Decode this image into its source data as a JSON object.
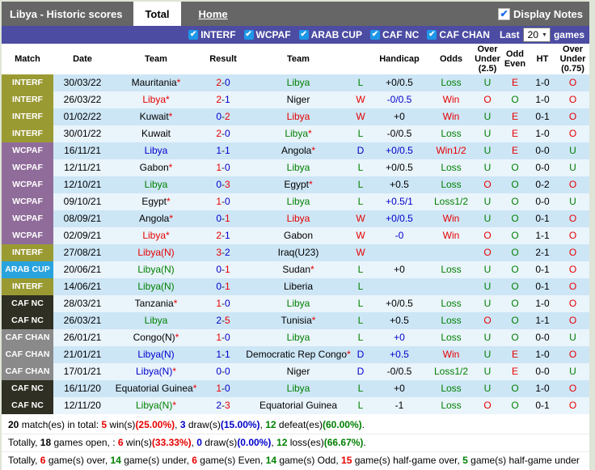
{
  "header": {
    "title": "Libya - Historic scores",
    "tabs": [
      {
        "label": "Total",
        "active": true
      },
      {
        "label": "Home",
        "active": false
      }
    ],
    "display_notes": "Display Notes"
  },
  "filter_bar": {
    "filters": [
      "INTERF",
      "WCPAF",
      "ARAB CUP",
      "CAF NC",
      "CAF CHAN"
    ],
    "last_label": "Last",
    "games_count": "20",
    "games_label": "games"
  },
  "colors": {
    "text": {
      "red": "#e60000",
      "green": "#008000",
      "blue": "#0000cc",
      "black": "#000000"
    },
    "competitions": {
      "INTERF": "#9a9a33",
      "WCPAF": "#906c9a",
      "ARAB CUP": "#29a3de",
      "CAF NC": "#2f2f23",
      "CAF CHAN": "#8a8a8a"
    },
    "accents": {
      "topbar": "#666666",
      "filterbar": "#4c4ca3",
      "row_odd": "#cde6f6",
      "row_even": "#eaf4fb",
      "check_blue": "#1e97e8"
    }
  },
  "table": {
    "columns": [
      "Match",
      "Date",
      "Team",
      "Result",
      "Team",
      "",
      "Handicap",
      "Odds",
      "Over Under (2.5)",
      "Odd Even",
      "HT",
      "Over Under (0.75)"
    ],
    "rows": [
      {
        "comp": "INTERF",
        "date": "30/03/22",
        "t1": "Mauritania",
        "t1s": true,
        "t1c": "black",
        "s1": "2",
        "s1c": "red",
        "s2": "0",
        "s2c": "blue",
        "t2": "Libya",
        "t2s": false,
        "t2c": "green",
        "r": "L",
        "h": "+0/0.5",
        "hc": "black",
        "o": "Loss",
        "u": "U",
        "e": "E",
        "ht": "1-0",
        "p": "O"
      },
      {
        "comp": "INTERF",
        "date": "26/03/22",
        "t1": "Libya",
        "t1s": true,
        "t1c": "red",
        "s1": "2",
        "s1c": "red",
        "s2": "1",
        "s2c": "blue",
        "t2": "Niger",
        "t2s": false,
        "t2c": "black",
        "r": "W",
        "h": "-0/0.5",
        "hc": "blue",
        "o": "Win",
        "u": "O",
        "e": "O",
        "ht": "1-0",
        "p": "O"
      },
      {
        "comp": "INTERF",
        "date": "01/02/22",
        "t1": "Kuwait",
        "t1s": true,
        "t1c": "black",
        "s1": "0",
        "s1c": "blue",
        "s2": "2",
        "s2c": "red",
        "t2": "Libya",
        "t2s": false,
        "t2c": "red",
        "r": "W",
        "h": "+0",
        "hc": "black",
        "o": "Win",
        "u": "U",
        "e": "E",
        "ht": "0-1",
        "p": "O"
      },
      {
        "comp": "INTERF",
        "date": "30/01/22",
        "t1": "Kuwait",
        "t1s": false,
        "t1c": "black",
        "s1": "2",
        "s1c": "red",
        "s2": "0",
        "s2c": "blue",
        "t2": "Libya",
        "t2s": true,
        "t2c": "green",
        "r": "L",
        "h": "-0/0.5",
        "hc": "black",
        "o": "Loss",
        "u": "U",
        "e": "E",
        "ht": "1-0",
        "p": "O"
      },
      {
        "comp": "WCPAF",
        "date": "16/11/21",
        "t1": "Libya",
        "t1s": false,
        "t1c": "blue",
        "s1": "1",
        "s1c": "blue",
        "s2": "1",
        "s2c": "blue",
        "t2": "Angola",
        "t2s": true,
        "t2c": "black",
        "r": "D",
        "h": "+0/0.5",
        "hc": "blue",
        "o": "Win1/2",
        "u": "U",
        "e": "E",
        "ht": "0-0",
        "p": "U"
      },
      {
        "comp": "WCPAF",
        "date": "12/11/21",
        "t1": "Gabon",
        "t1s": true,
        "t1c": "black",
        "s1": "1",
        "s1c": "red",
        "s2": "0",
        "s2c": "blue",
        "t2": "Libya",
        "t2s": false,
        "t2c": "green",
        "r": "L",
        "h": "+0/0.5",
        "hc": "black",
        "o": "Loss",
        "u": "U",
        "e": "O",
        "ht": "0-0",
        "p": "U"
      },
      {
        "comp": "WCPAF",
        "date": "12/10/21",
        "t1": "Libya",
        "t1s": false,
        "t1c": "green",
        "s1": "0",
        "s1c": "blue",
        "s2": "3",
        "s2c": "red",
        "t2": "Egypt",
        "t2s": true,
        "t2c": "black",
        "r": "L",
        "h": "+0.5",
        "hc": "black",
        "o": "Loss",
        "u": "O",
        "e": "O",
        "ht": "0-2",
        "p": "O"
      },
      {
        "comp": "WCPAF",
        "date": "09/10/21",
        "t1": "Egypt",
        "t1s": true,
        "t1c": "black",
        "s1": "1",
        "s1c": "red",
        "s2": "0",
        "s2c": "blue",
        "t2": "Libya",
        "t2s": false,
        "t2c": "green",
        "r": "L",
        "h": "+0.5/1",
        "hc": "blue",
        "o": "Loss1/2",
        "u": "U",
        "e": "O",
        "ht": "0-0",
        "p": "U"
      },
      {
        "comp": "WCPAF",
        "date": "08/09/21",
        "t1": "Angola",
        "t1s": true,
        "t1c": "black",
        "s1": "0",
        "s1c": "blue",
        "s2": "1",
        "s2c": "red",
        "t2": "Libya",
        "t2s": false,
        "t2c": "red",
        "r": "W",
        "h": "+0/0.5",
        "hc": "blue",
        "o": "Win",
        "u": "U",
        "e": "O",
        "ht": "0-1",
        "p": "O"
      },
      {
        "comp": "WCPAF",
        "date": "02/09/21",
        "t1": "Libya",
        "t1s": true,
        "t1c": "red",
        "s1": "2",
        "s1c": "red",
        "s2": "1",
        "s2c": "blue",
        "t2": "Gabon",
        "t2s": false,
        "t2c": "black",
        "r": "W",
        "h": "-0",
        "hc": "blue",
        "o": "Win",
        "u": "O",
        "e": "O",
        "ht": "1-1",
        "p": "O"
      },
      {
        "comp": "INTERF",
        "date": "27/08/21",
        "t1": "Libya(N)",
        "t1s": false,
        "t1c": "red",
        "s1": "3",
        "s1c": "red",
        "s2": "2",
        "s2c": "blue",
        "t2": "Iraq(U23)",
        "t2s": false,
        "t2c": "black",
        "r": "W",
        "h": "",
        "hc": "black",
        "o": "",
        "u": "O",
        "e": "O",
        "ht": "2-1",
        "p": "O"
      },
      {
        "comp": "ARAB CUP",
        "date": "20/06/21",
        "t1": "Libya(N)",
        "t1s": false,
        "t1c": "green",
        "s1": "0",
        "s1c": "blue",
        "s2": "1",
        "s2c": "red",
        "t2": "Sudan",
        "t2s": true,
        "t2c": "black",
        "r": "L",
        "h": "+0",
        "hc": "black",
        "o": "Loss",
        "u": "U",
        "e": "O",
        "ht": "0-1",
        "p": "O"
      },
      {
        "comp": "INTERF",
        "date": "14/06/21",
        "t1": "Libya(N)",
        "t1s": false,
        "t1c": "green",
        "s1": "0",
        "s1c": "blue",
        "s2": "1",
        "s2c": "red",
        "t2": "Liberia",
        "t2s": false,
        "t2c": "black",
        "r": "L",
        "h": "",
        "hc": "black",
        "o": "",
        "u": "U",
        "e": "O",
        "ht": "0-1",
        "p": "O"
      },
      {
        "comp": "CAF NC",
        "date": "28/03/21",
        "t1": "Tanzania",
        "t1s": true,
        "t1c": "black",
        "s1": "1",
        "s1c": "red",
        "s2": "0",
        "s2c": "blue",
        "t2": "Libya",
        "t2s": false,
        "t2c": "green",
        "r": "L",
        "h": "+0/0.5",
        "hc": "black",
        "o": "Loss",
        "u": "U",
        "e": "O",
        "ht": "1-0",
        "p": "O"
      },
      {
        "comp": "CAF NC",
        "date": "26/03/21",
        "t1": "Libya",
        "t1s": false,
        "t1c": "green",
        "s1": "2",
        "s1c": "blue",
        "s2": "5",
        "s2c": "red",
        "t2": "Tunisia",
        "t2s": true,
        "t2c": "black",
        "r": "L",
        "h": "+0.5",
        "hc": "black",
        "o": "Loss",
        "u": "O",
        "e": "O",
        "ht": "1-1",
        "p": "O"
      },
      {
        "comp": "CAF CHAN",
        "date": "26/01/21",
        "t1": "Congo(N)",
        "t1s": true,
        "t1c": "black",
        "s1": "1",
        "s1c": "red",
        "s2": "0",
        "s2c": "blue",
        "t2": "Libya",
        "t2s": false,
        "t2c": "green",
        "r": "L",
        "h": "+0",
        "hc": "blue",
        "o": "Loss",
        "u": "U",
        "e": "O",
        "ht": "0-0",
        "p": "U"
      },
      {
        "comp": "CAF CHAN",
        "date": "21/01/21",
        "t1": "Libya(N)",
        "t1s": false,
        "t1c": "blue",
        "s1": "1",
        "s1c": "blue",
        "s2": "1",
        "s2c": "blue",
        "t2": "Democratic Rep Congo",
        "t2s": true,
        "t2c": "black",
        "r": "D",
        "h": "+0.5",
        "hc": "blue",
        "o": "Win",
        "u": "U",
        "e": "E",
        "ht": "1-0",
        "p": "O"
      },
      {
        "comp": "CAF CHAN",
        "date": "17/01/21",
        "t1": "Libya(N)",
        "t1s": true,
        "t1c": "blue",
        "s1": "0",
        "s1c": "blue",
        "s2": "0",
        "s2c": "blue",
        "t2": "Niger",
        "t2s": false,
        "t2c": "black",
        "r": "D",
        "h": "-0/0.5",
        "hc": "black",
        "o": "Loss1/2",
        "u": "U",
        "e": "E",
        "ht": "0-0",
        "p": "U"
      },
      {
        "comp": "CAF NC",
        "date": "16/11/20",
        "t1": "Equatorial Guinea",
        "t1s": true,
        "t1c": "black",
        "s1": "1",
        "s1c": "red",
        "s2": "0",
        "s2c": "blue",
        "t2": "Libya",
        "t2s": false,
        "t2c": "green",
        "r": "L",
        "h": "+0",
        "hc": "black",
        "o": "Loss",
        "u": "U",
        "e": "O",
        "ht": "1-0",
        "p": "O"
      },
      {
        "comp": "CAF NC",
        "date": "12/11/20",
        "t1": "Libya(N)",
        "t1s": true,
        "t1c": "green",
        "s1": "2",
        "s1c": "blue",
        "s2": "3",
        "s2c": "red",
        "t2": "Equatorial Guinea",
        "t2s": false,
        "t2c": "black",
        "r": "L",
        "h": "-1",
        "hc": "black",
        "o": "Loss",
        "u": "O",
        "e": "O",
        "ht": "0-1",
        "p": "O"
      }
    ]
  },
  "footer": {
    "lines": [
      [
        {
          "t": "20",
          "b": true
        },
        {
          "t": " match(es) in total: "
        },
        {
          "t": "5",
          "c": "red",
          "b": true
        },
        {
          "t": " win(s)"
        },
        {
          "t": "(25.00%)",
          "c": "red",
          "b": true
        },
        {
          "t": ", "
        },
        {
          "t": "3",
          "c": "blue",
          "b": true
        },
        {
          "t": " draw(s)"
        },
        {
          "t": "(15.00%)",
          "c": "blue",
          "b": true
        },
        {
          "t": ", "
        },
        {
          "t": "12",
          "c": "green",
          "b": true
        },
        {
          "t": " defeat(es)"
        },
        {
          "t": "(60.00%)",
          "c": "green",
          "b": true
        },
        {
          "t": "."
        }
      ],
      [
        {
          "t": "Totally, "
        },
        {
          "t": "18",
          "b": true
        },
        {
          "t": " games open, : "
        },
        {
          "t": "6",
          "c": "red",
          "b": true
        },
        {
          "t": " win(s)"
        },
        {
          "t": "(33.33%)",
          "c": "red",
          "b": true
        },
        {
          "t": ", "
        },
        {
          "t": "0",
          "c": "blue",
          "b": true
        },
        {
          "t": " draw(s)"
        },
        {
          "t": "(0.00%)",
          "c": "blue",
          "b": true
        },
        {
          "t": ", "
        },
        {
          "t": "12",
          "c": "green",
          "b": true
        },
        {
          "t": " loss(es)"
        },
        {
          "t": "(66.67%)",
          "c": "green",
          "b": true
        },
        {
          "t": "."
        }
      ],
      [
        {
          "t": "Totally, "
        },
        {
          "t": "6",
          "c": "red",
          "b": true
        },
        {
          "t": " game(s) over, "
        },
        {
          "t": "14",
          "c": "green",
          "b": true
        },
        {
          "t": " game(s) under, "
        },
        {
          "t": "6",
          "c": "red",
          "b": true
        },
        {
          "t": " game(s) Even, "
        },
        {
          "t": "14",
          "c": "green",
          "b": true
        },
        {
          "t": " game(s) Odd, "
        },
        {
          "t": "15",
          "c": "red",
          "b": true
        },
        {
          "t": " game(s) half-game over, "
        },
        {
          "t": "5",
          "c": "green",
          "b": true
        },
        {
          "t": " game(s) half-game under"
        }
      ]
    ]
  }
}
